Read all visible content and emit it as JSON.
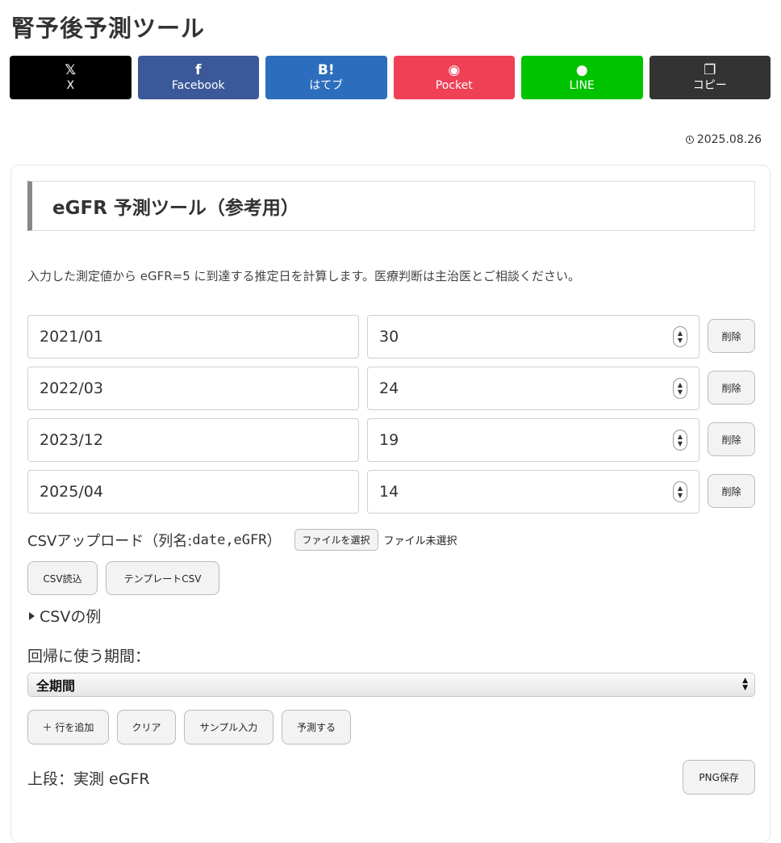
{
  "page": {
    "title": "腎予後予測ツール"
  },
  "share": [
    {
      "icon": "𝕏",
      "label": "X",
      "color": "#000000"
    },
    {
      "icon": "f",
      "label": "Facebook",
      "color": "#3b5998"
    },
    {
      "icon": "B!",
      "label": "はてブ",
      "color": "#2c6ebd"
    },
    {
      "icon": "◉",
      "label": "Pocket",
      "color": "#ef4056"
    },
    {
      "icon": "●",
      "label": "LINE",
      "color": "#00c300"
    },
    {
      "icon": "❐",
      "label": "コピー",
      "color": "#333333"
    }
  ],
  "post": {
    "date": "2025.08.26"
  },
  "tool": {
    "heading": "eGFR 予測ツール（参考用）",
    "description": "入力した測定値から eGFR=5 に到達する推定日を計算します。医療判断は主治医とご相談ください。",
    "rows": [
      {
        "date": "2021/01",
        "egfr": "30"
      },
      {
        "date": "2022/03",
        "egfr": "24"
      },
      {
        "date": "2023/12",
        "egfr": "19"
      },
      {
        "date": "2025/04",
        "egfr": "14"
      }
    ],
    "delete_label": "削除",
    "csv": {
      "label_prefix": "CSVアップロード（列名: ",
      "label_columns": "date,eGFR",
      "label_suffix": "）",
      "file_button": "ファイルを選択",
      "file_status": "ファイル未選択",
      "load_button": "CSV読込",
      "template_button": "テンプレートCSV",
      "example_summary": "CSVの例"
    },
    "period": {
      "label": "回帰に使う期間：",
      "selected": "全期間"
    },
    "actions": {
      "add_row": "＋ 行を追加",
      "clear": "クリア",
      "sample": "サンプル入力",
      "predict": "予測する"
    },
    "chart": {
      "label": "上段：実測 eGFR",
      "png_button": "PNG保存"
    }
  }
}
